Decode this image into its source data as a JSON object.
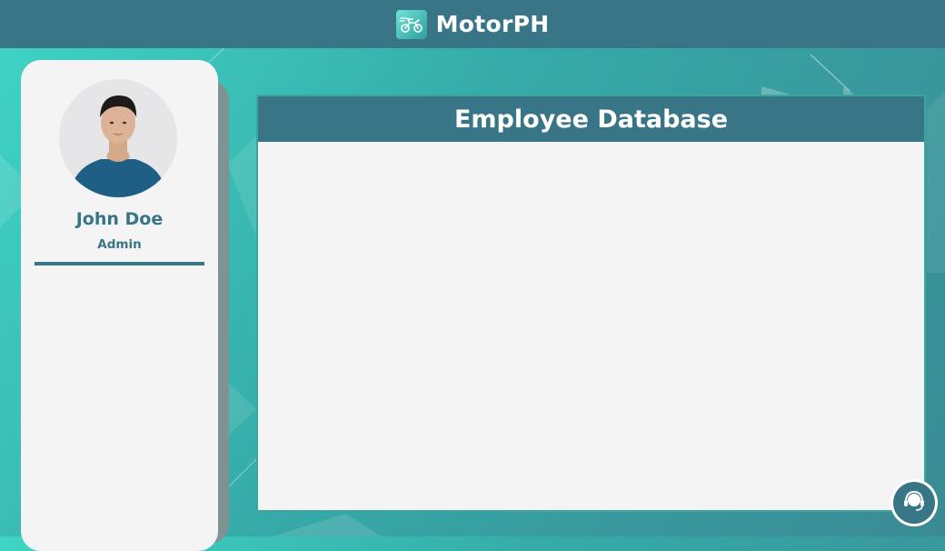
{
  "app": {
    "title": "MotorPH"
  },
  "user": {
    "name": "John Doe",
    "role": "Admin"
  },
  "main": {
    "panel_title": "Employee Database"
  },
  "icons": {
    "logo": "motorcycle-logo-icon",
    "avatar": "user-avatar-photo",
    "support": "headset-support-icon"
  },
  "colors": {
    "primary": "#387587",
    "background_start": "#3fd4c6",
    "background_end": "#3a8a94",
    "panel_bg": "#f4f4f4",
    "panel_border": "#3aa79c"
  }
}
